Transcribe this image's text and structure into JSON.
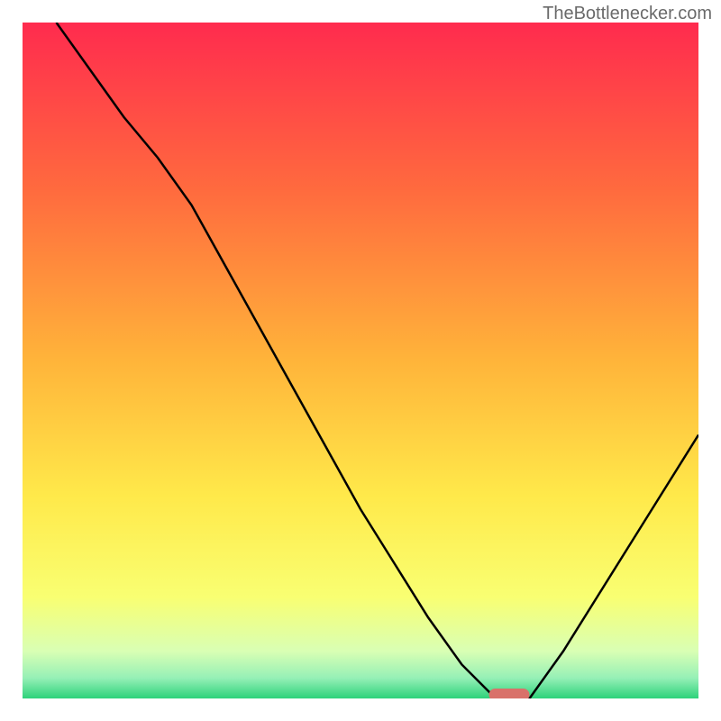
{
  "watermark": "TheBottlenecker.com",
  "chart_data": {
    "type": "line",
    "title": "",
    "xlabel": "",
    "ylabel": "",
    "xlim": [
      0,
      100
    ],
    "ylim": [
      0,
      100
    ],
    "x": [
      5,
      10,
      15,
      20,
      25,
      30,
      35,
      40,
      45,
      50,
      55,
      60,
      65,
      70,
      72,
      75,
      80,
      85,
      90,
      95,
      100
    ],
    "y": [
      100,
      93,
      86,
      80,
      73,
      64,
      55,
      46,
      37,
      28,
      20,
      12,
      5,
      0,
      0,
      0,
      7,
      15,
      23,
      31,
      39
    ],
    "marker": {
      "x": 72,
      "width": 6,
      "color": "#d9716a"
    },
    "background_gradient": {
      "stops": [
        {
          "offset": 0.0,
          "color": "#ff2b4e"
        },
        {
          "offset": 0.25,
          "color": "#ff6b3e"
        },
        {
          "offset": 0.5,
          "color": "#ffb43a"
        },
        {
          "offset": 0.7,
          "color": "#ffe94a"
        },
        {
          "offset": 0.85,
          "color": "#f9ff72"
        },
        {
          "offset": 0.93,
          "color": "#d9ffb4"
        },
        {
          "offset": 0.97,
          "color": "#95f0b6"
        },
        {
          "offset": 1.0,
          "color": "#2dd27a"
        }
      ]
    }
  }
}
